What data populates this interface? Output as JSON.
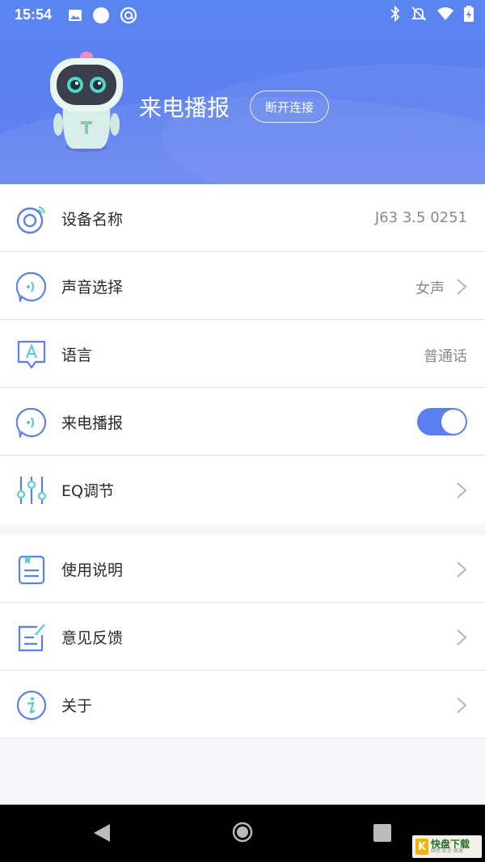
{
  "status_bar": {
    "time": "15:54",
    "left_icons": [
      "image-icon",
      "circle-icon",
      "at-sign-icon"
    ],
    "right_icons": [
      "bluetooth-icon",
      "muted-bell-icon",
      "wifi-icon",
      "battery-icon"
    ]
  },
  "header": {
    "device_title": "来电播报",
    "disconnect_label": "断开连接",
    "gradient_colors": [
      "#5a86f1",
      "#6b86f2"
    ]
  },
  "settings": [
    {
      "key": "device_name",
      "icon": "device-signal-icon",
      "label": "设备名称",
      "value": "J63 3.5 0251",
      "chevron": false
    },
    {
      "key": "voice",
      "icon": "voice-bubble-icon",
      "label": "声音选择",
      "value": "女声",
      "chevron": true
    },
    {
      "key": "language",
      "icon": "language-a-icon",
      "label": "语言",
      "value": "普通话",
      "chevron": false
    },
    {
      "key": "call_announce",
      "icon": "voice-bubble-icon",
      "label": "来电播报",
      "toggle": true
    },
    {
      "key": "eq",
      "icon": "eq-sliders-icon",
      "label": "EQ调节",
      "chevron": true
    }
  ],
  "more": [
    {
      "key": "instructions",
      "icon": "manual-icon",
      "label": "使用说明",
      "chevron": true
    },
    {
      "key": "feedback",
      "icon": "feedback-edit-icon",
      "label": "意见反馈",
      "chevron": true
    },
    {
      "key": "about",
      "icon": "info-icon",
      "label": "关于",
      "chevron": true
    }
  ],
  "accent_color": "#5a80f0",
  "watermark": {
    "logo": "K",
    "text": "快盘下载",
    "sub": "绿色·安全·高速"
  }
}
